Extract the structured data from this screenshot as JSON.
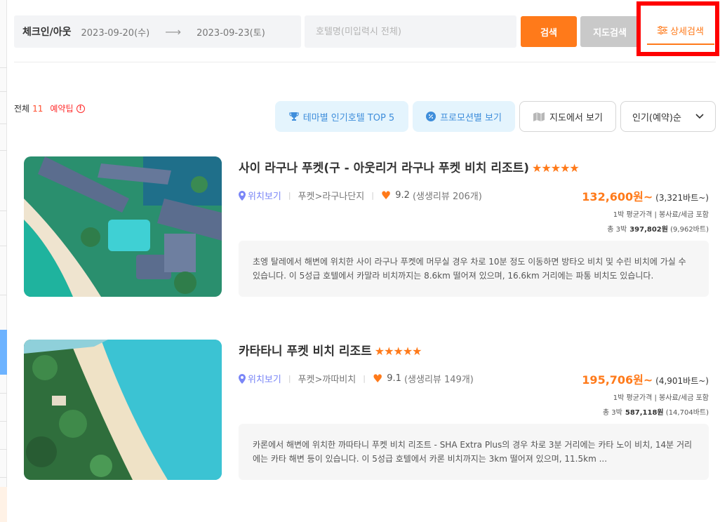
{
  "search": {
    "checkin_label": "체크인/아웃",
    "checkin_date": "2023-09-20(수)",
    "arrow": "⟶",
    "checkout_date": "2023-09-23(토)",
    "hotel_placeholder": "호텔명(미입력시 전체)",
    "search_button": "검색",
    "map_search_button": "지도검색",
    "detail_search_button": "상세검색"
  },
  "toolbar": {
    "total_label": "전체",
    "total_count": "11",
    "tip_label": "예약팁",
    "theme_button": "테마별 인기호텔 TOP 5",
    "promo_button": "프로모션별 보기",
    "map_view_button": "지도에서 보기",
    "sort_selected": "인기(예약)순"
  },
  "hotels": [
    {
      "name": "사이 라구나 푸켓(구 - 아웃리거 라구나 푸켓 비치 리조트)",
      "stars": "★★★★★",
      "location_link": "위치보기",
      "area": "푸켓>라구나단지",
      "rating": "9.2",
      "reviews": "(생생리뷰 206개)",
      "price": "132,600원~",
      "price_baht": "(3,321바트~)",
      "price_note": "1박 평균가격 | 봉사료/세금 포함",
      "total_label": "총 3박",
      "total_price": "397,802원",
      "total_baht": "(9,962바트)",
      "description": "초엥 탈레에서 해변에 위치한 사이 라구나 푸켓에 머무실 경우 차로 10분 정도 이동하면 방타오 비치 및 수린 비치에 가실 수 있습니다. 이 5성급 호텔에서 카말라 비치까지는 8.6km 떨어져 있으며, 16.6km 거리에는 파통 비치도 있습니다."
    },
    {
      "name": "카타타니 푸켓 비치 리조트",
      "stars": "★★★★★",
      "location_link": "위치보기",
      "area": "푸켓>까따비치",
      "rating": "9.1",
      "reviews": "(생생리뷰 149개)",
      "price": "195,706원~",
      "price_baht": "(4,901바트~)",
      "price_note": "1박 평균가격 | 봉사료/세금 포함",
      "total_label": "총 3박",
      "total_price": "587,118원",
      "total_baht": "(14,704바트)",
      "description": "카론에서 해변에 위치한 까따타니 푸켓 비치 리조트 - SHA Extra Plus의 경우 차로 3분 거리에는 카타 노이 비치, 14분 거리에는 카타 해변 등이 있습니다. 이 5성급 호텔에서 카론 비치까지는 3km 떨어져 있으며, 11.5km ..."
    }
  ],
  "colors": {
    "accent": "#ff7a1a",
    "highlight": "#ff0000",
    "link": "#7a86f7",
    "chip_bg": "#e4f4fd",
    "chip_text": "#3f8edb"
  }
}
